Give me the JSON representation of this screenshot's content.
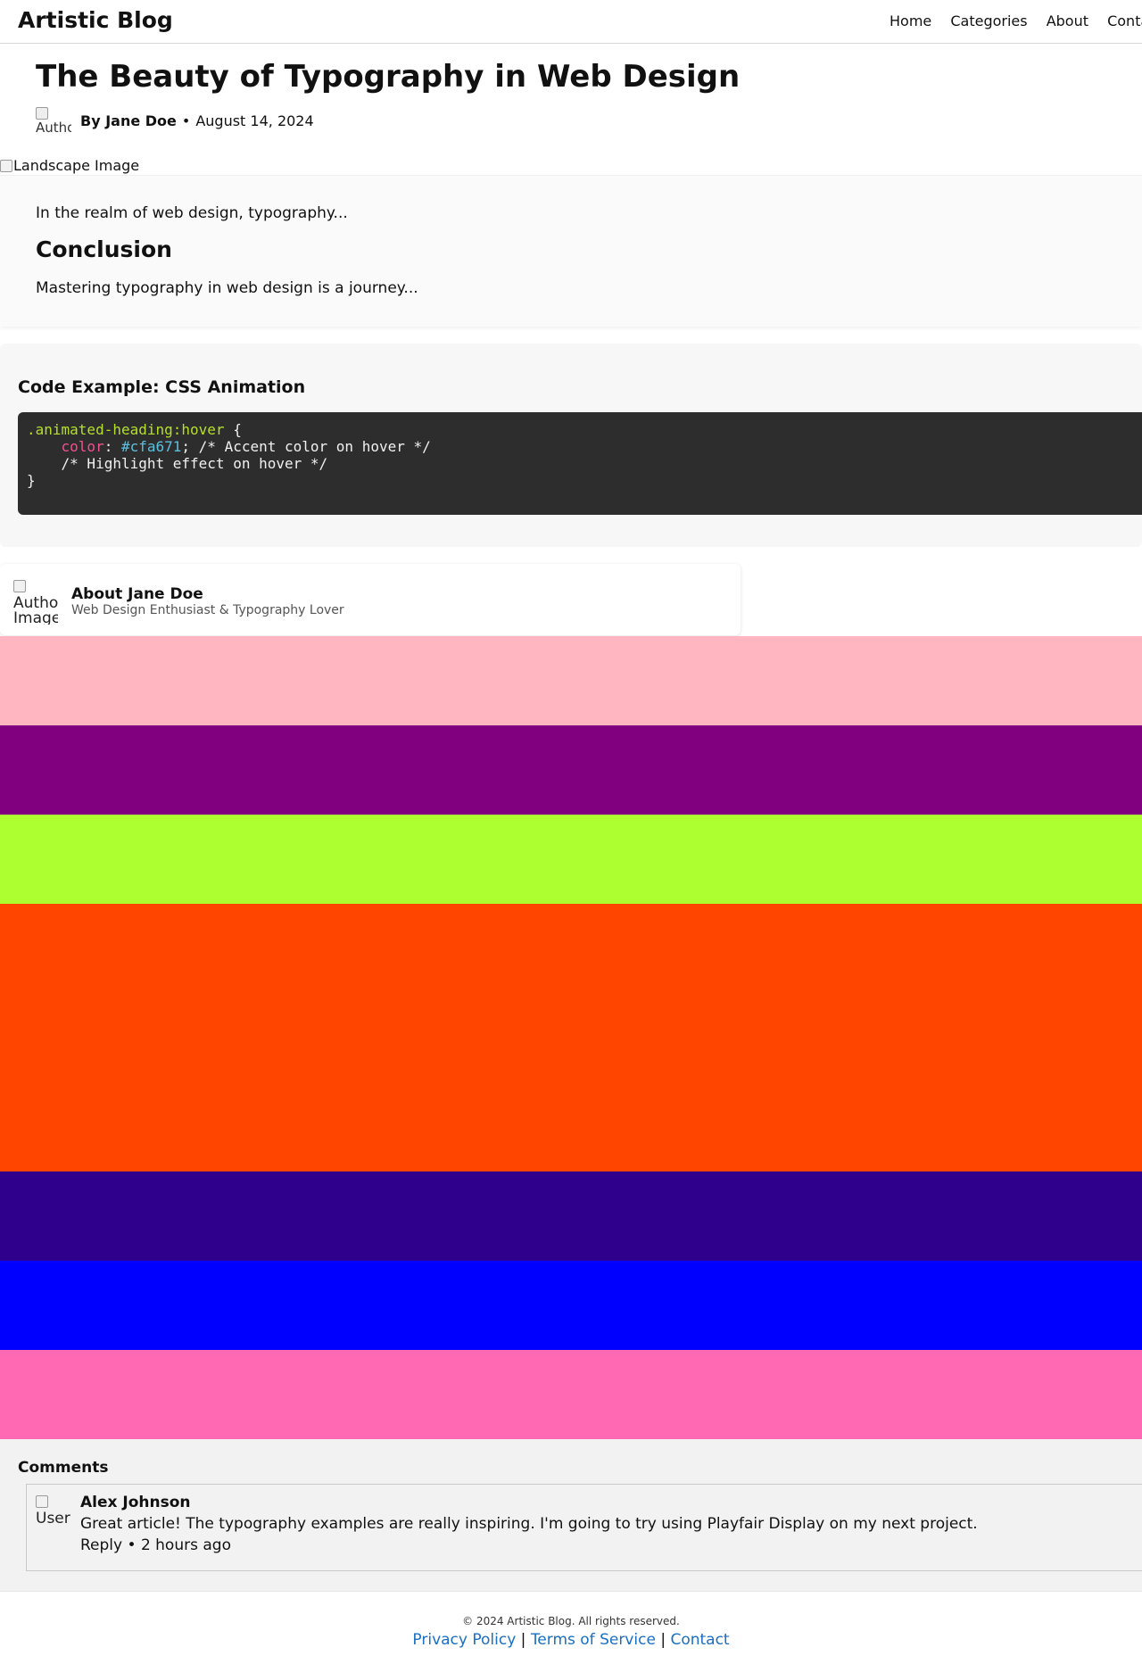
{
  "header": {
    "site_title": "Artistic Blog",
    "nav": [
      "Home",
      "Categories",
      "About",
      "Conta"
    ]
  },
  "article": {
    "title": "The Beauty of Typography in Web Design",
    "author_img_alt": "Author",
    "author_label": "By Jane Doe",
    "separator": "•",
    "date": "August 14, 2024",
    "hero_alt": "Landscape Image",
    "intro": "In the realm of web design, typography...",
    "conclusion_heading": "Conclusion",
    "conclusion_text": "Mastering typography in web design is a journey..."
  },
  "code": {
    "title": "Code Example: CSS Animation",
    "selector": ".animated-heading:hover",
    "open_brace": " {",
    "prop": "color",
    "colon": ": ",
    "value": "#cfa671",
    "semicolon_comment": "; /* Accent color on hover */",
    "comment2": "    /* Highlight effect on hover */",
    "close_brace": "}"
  },
  "author_card": {
    "img_alt": "Author Image",
    "name": "About Jane Doe",
    "role": "Web Design Enthusiast & Typography Lover"
  },
  "bands": {
    "colors": [
      "#ffb6c1",
      "#800080",
      "#adff2f",
      "#ff4500",
      "#2e008b",
      "#0000ff",
      "#ff69b4"
    ]
  },
  "comments": {
    "title": "Comments",
    "items": [
      {
        "img_alt": "User",
        "name": "Alex Johnson",
        "text": "Great article! The typography examples are really inspiring. I'm going to try using Playfair Display on my next project.",
        "reply": "Reply",
        "sep": "•",
        "time": "2 hours ago"
      }
    ]
  },
  "footer": {
    "copyright": "© 2024 Artistic Blog. All rights reserved.",
    "links": [
      "Privacy Policy",
      "Terms of Service",
      "Contact"
    ],
    "divider": "|"
  }
}
